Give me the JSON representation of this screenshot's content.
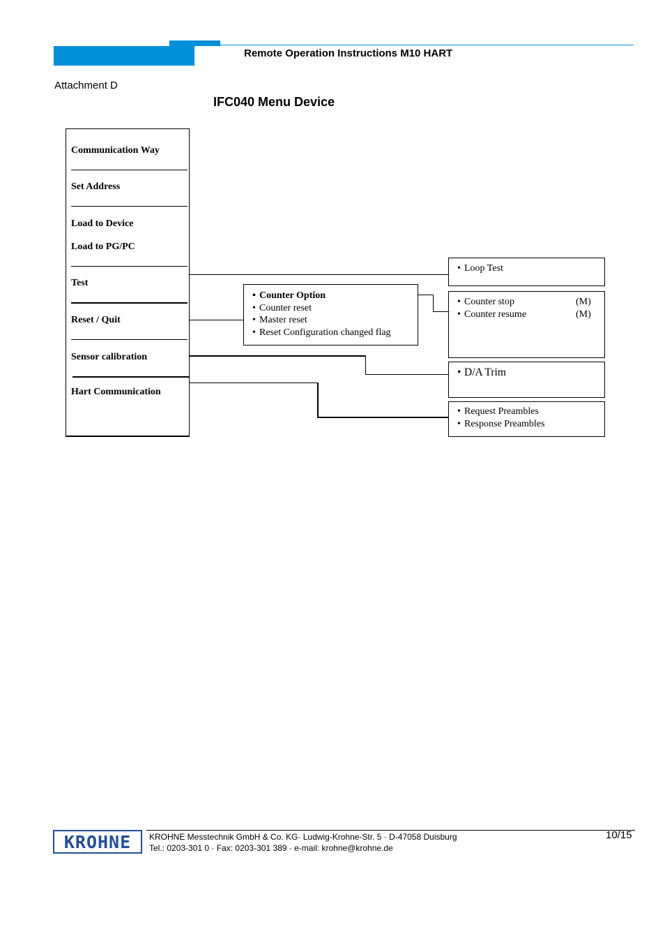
{
  "header": {
    "title": "Remote Operation Instructions M10 HART",
    "brand_color": "#0090da"
  },
  "attachment_label": "Attachment D",
  "diagram_title": "IFC040 Menu Device",
  "menu": {
    "items": [
      "Communication Way",
      "Set Address",
      "Load to Device",
      "Load to PG/PC",
      "Test",
      "Reset / Quit",
      "Sensor calibration",
      "Hart Communication"
    ]
  },
  "submenus": {
    "reset": {
      "items": [
        "Counter Option",
        "Counter reset",
        "Master reset",
        "Reset Configuration changed flag"
      ]
    },
    "loop_test": {
      "items": [
        "Loop Test"
      ]
    },
    "counter": {
      "items": [
        {
          "label": "Counter stop",
          "suffix": "(M)"
        },
        {
          "label": "Counter resume",
          "suffix": "(M)"
        }
      ]
    },
    "da_trim": {
      "items": [
        "D/A Trim"
      ]
    },
    "preambles": {
      "items": [
        "Request Preambles",
        "Response Preambles"
      ]
    }
  },
  "bullet": "•",
  "footer": {
    "logo_text": "KROHNE",
    "logo_color": "#1f4f9c",
    "line1": "KROHNE Messtechnik GmbH & Co. KG·  Ludwig-Krohne-Str. 5 · D-47058 Duisburg",
    "line2": "Tel.: 0203-301 0 · Fax: 0203-301 389 ·   e-mail: krohne@krohne.de",
    "page": "10/15"
  }
}
